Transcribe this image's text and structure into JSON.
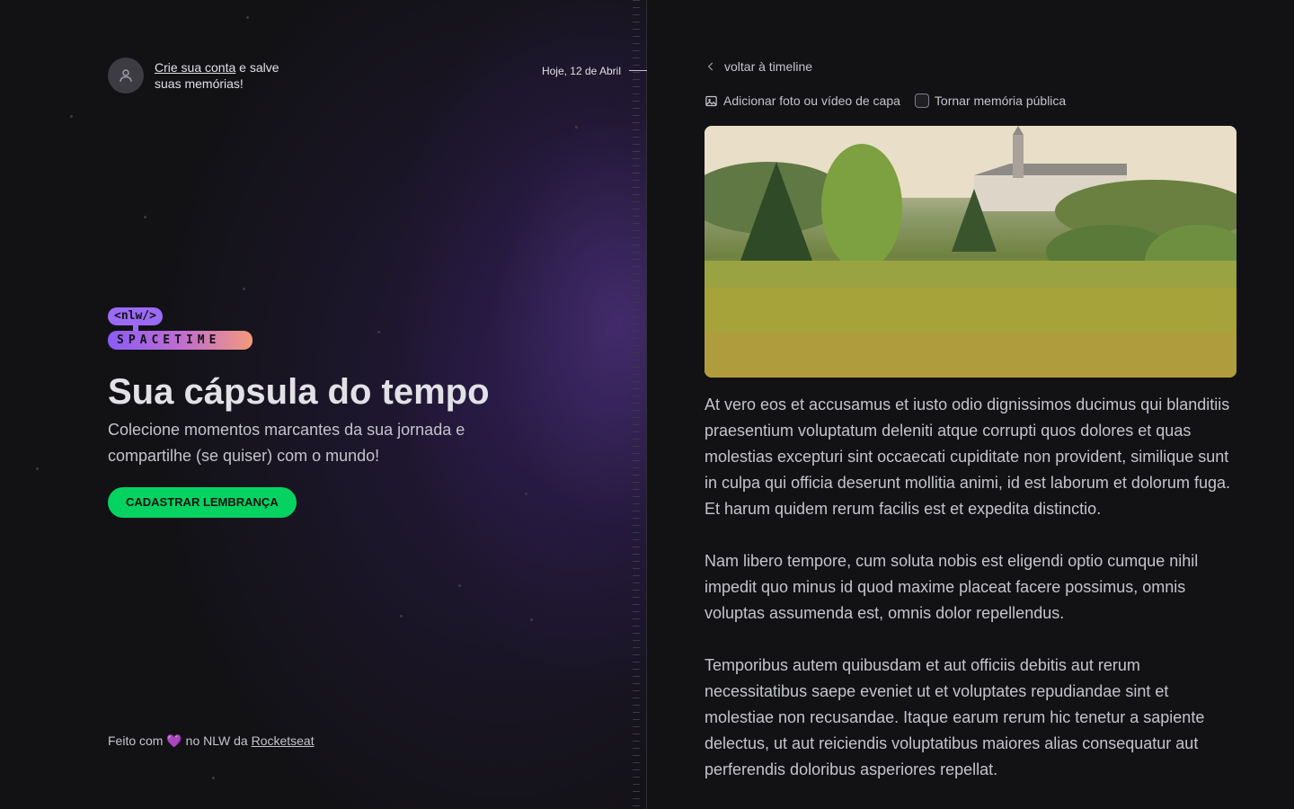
{
  "sidebar": {
    "signin": {
      "link": "Crie sua conta",
      "rest": " e salve suas memórias!"
    },
    "today": "Hoje, 12 de Abril",
    "logo": {
      "top": "<nlw/>",
      "bottom": "SPACETIME"
    },
    "headline": "Sua cápsula do tempo",
    "subtitle": "Colecione momentos marcantes da sua jornada e compartilhe (se quiser) com o mundo!",
    "cta": "CADASTRAR LEMBRANÇA",
    "footer": {
      "prefix": "Feito com ",
      "heart": "💜",
      "middle": " no NLW da ",
      "link": "Rocketseat"
    }
  },
  "memory": {
    "back": "voltar à timeline",
    "add_cover": "Adicionar foto ou vídeo de capa",
    "public_label": "Tornar memória pública",
    "paragraphs": [
      "At vero eos et accusamus et iusto odio dignissimos ducimus qui blanditiis praesentium voluptatum deleniti atque corrupti quos dolores et quas molestias excepturi sint occaecati cupiditate non provident, similique sunt in culpa qui officia deserunt mollitia animi, id est laborum et dolorum fuga. Et harum quidem rerum facilis est et expedita distinctio.",
      "Nam libero tempore, cum soluta nobis est eligendi optio cumque nihil impedit quo minus id quod maxime placeat facere possimus, omnis voluptas assumenda est, omnis dolor repellendus.",
      "Temporibus autem quibusdam et aut officiis debitis aut rerum necessitatibus saepe eveniet ut et voluptates repudiandae sint et molestiae non recusandae. Itaque earum rerum hic tenetur a sapiente delectus, ut aut reiciendis voluptatibus maiores alias consequatur aut perferendis doloribus asperiores repellat."
    ]
  },
  "colors": {
    "accent_green": "#04d361",
    "purple": "#9b6bf6",
    "background": "#121215",
    "text": "#c4c4cc"
  },
  "icons": [
    "user-icon",
    "chevron-left-icon",
    "image-icon",
    "heart-icon"
  ]
}
